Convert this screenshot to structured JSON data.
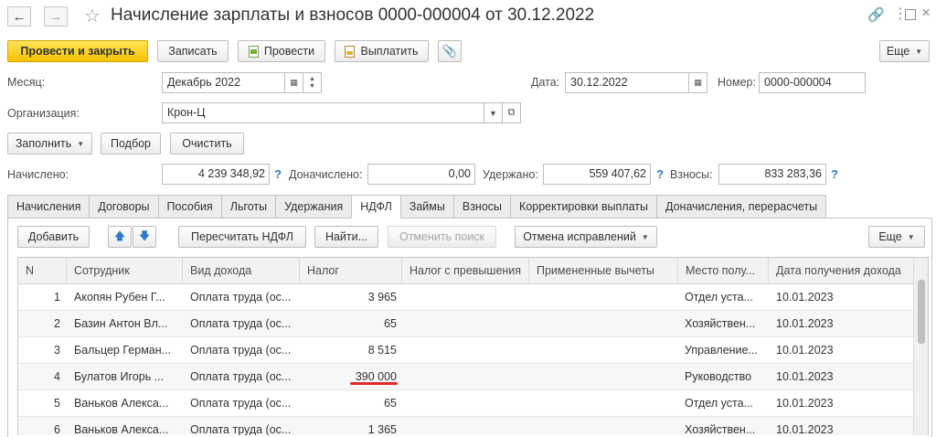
{
  "window": {
    "title": "Начисление зарплаты и взносов 0000-000004 от 30.12.2022",
    "link_icon": "link-icon",
    "more_icon": "more-vertical-icon",
    "maximize_icon": "maximize-icon",
    "close_icon": "close-icon"
  },
  "toolbar": {
    "post_close": "Провести и закрыть",
    "save": "Записать",
    "post": "Провести",
    "pay": "Выплатить",
    "more": "Еще"
  },
  "header": {
    "month_label": "Месяц:",
    "month_value": "Декабрь 2022",
    "date_label": "Дата:",
    "date_value": "30.12.2022",
    "number_label": "Номер:",
    "number_value": "0000-000004",
    "org_label": "Организация:",
    "org_value": "Крон-Ц"
  },
  "actions": {
    "fill": "Заполнить",
    "select": "Подбор",
    "clear": "Очистить"
  },
  "totals": {
    "accrued_label": "Начислено:",
    "accrued_value": "4 239 348,92",
    "extra_label": "Доначислено:",
    "extra_value": "0,00",
    "withheld_label": "Удержано:",
    "withheld_value": "559 407,62",
    "contrib_label": "Взносы:",
    "contrib_value": "833 283,36",
    "help": "?"
  },
  "tabs": [
    {
      "label": "Начисления"
    },
    {
      "label": "Договоры"
    },
    {
      "label": "Пособия"
    },
    {
      "label": "Льготы"
    },
    {
      "label": "Удержания"
    },
    {
      "label": "НДФЛ"
    },
    {
      "label": "Займы"
    },
    {
      "label": "Взносы"
    },
    {
      "label": "Корректировки выплаты"
    },
    {
      "label": "Доначисления, перерасчеты"
    }
  ],
  "tab_toolbar": {
    "add": "Добавить",
    "recalc": "Пересчитать НДФЛ",
    "find": "Найти...",
    "cancel_search": "Отменить поиск",
    "undo_fix": "Отмена исправлений",
    "more": "Еще"
  },
  "table": {
    "columns": [
      "N",
      "Сотрудник",
      "Вид дохода",
      "Налог",
      "Налог с превышения",
      "Примененные вычеты",
      "Место полу...",
      "Дата получения дохода"
    ],
    "rows": [
      {
        "n": "1",
        "employee": "Акопян Рубен Г...",
        "income": "Оплата труда (ос...",
        "tax": "3 965",
        "excess": "",
        "deduction": "",
        "place": "Отдел уста...",
        "date": "10.01.2023"
      },
      {
        "n": "2",
        "employee": "Базин Антон Вл...",
        "income": "Оплата труда (ос...",
        "tax": "65",
        "excess": "",
        "deduction": "",
        "place": "Хозяйствен...",
        "date": "10.01.2023"
      },
      {
        "n": "3",
        "employee": "Бальцер Герман...",
        "income": "Оплата труда (ос...",
        "tax": "8 515",
        "excess": "",
        "deduction": "",
        "place": "Управление...",
        "date": "10.01.2023"
      },
      {
        "n": "4",
        "employee": "Булатов Игорь ...",
        "income": "Оплата труда (ос...",
        "tax": "390 000",
        "excess": "",
        "deduction": "",
        "place": "Руководство",
        "date": "10.01.2023"
      },
      {
        "n": "5",
        "employee": "Ваньков Алекса...",
        "income": "Оплата труда (ос...",
        "tax": "65",
        "excess": "",
        "deduction": "",
        "place": "Отдел уста...",
        "date": "10.01.2023"
      },
      {
        "n": "6",
        "employee": "Ваньков Алекса...",
        "income": "Оплата труда (ос...",
        "tax": "1 365",
        "excess": "",
        "deduction": "",
        "place": "Хозяйствен...",
        "date": "10.01.2023"
      }
    ]
  },
  "colors": {
    "primary_button": "#f4c400",
    "help_mark": "#2f79c7",
    "highlight_underline": "#e12b2b"
  }
}
